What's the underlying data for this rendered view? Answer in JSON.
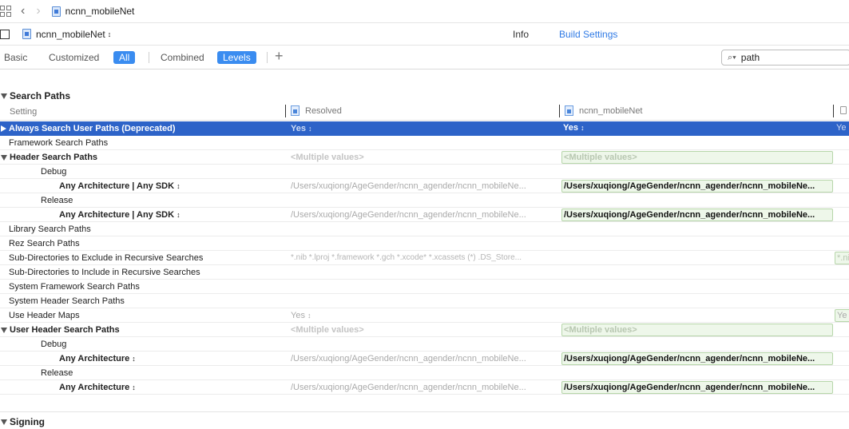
{
  "jumpbar": {
    "file_label": "ncnn_mobileNet"
  },
  "targetbar": {
    "target_label": "ncnn_mobileNet",
    "tab_info": "Info",
    "tab_build_settings": "Build Settings"
  },
  "filterbar": {
    "basic": "Basic",
    "customized": "Customized",
    "all": "All",
    "combined": "Combined",
    "levels": "Levels",
    "search_value": "path"
  },
  "section": {
    "search_paths": "Search Paths",
    "signing": "Signing"
  },
  "columns": {
    "setting": "Setting",
    "resolved": "Resolved",
    "target": "ncnn_mobileNet"
  },
  "rows": [
    {
      "name": "Always Search User Paths (Deprecated)",
      "resolved": "Yes",
      "target": "Yes",
      "extra": "Ye"
    },
    {
      "name": "Framework Search Paths",
      "resolved": "",
      "target": ""
    },
    {
      "name": "Header Search Paths",
      "resolved": "<Multiple values>",
      "target": "<Multiple values>"
    },
    {
      "name": "Debug",
      "resolved": "",
      "target": ""
    },
    {
      "name": "Any Architecture | Any SDK",
      "resolved": "/Users/xuqiong/AgeGender/ncnn_agender/ncnn_mobileNe...",
      "target": "/Users/xuqiong/AgeGender/ncnn_agender/ncnn_mobileNe..."
    },
    {
      "name": "Release",
      "resolved": "",
      "target": ""
    },
    {
      "name": "Any Architecture | Any SDK",
      "resolved": "/Users/xuqiong/AgeGender/ncnn_agender/ncnn_mobileNe...",
      "target": "/Users/xuqiong/AgeGender/ncnn_agender/ncnn_mobileNe..."
    },
    {
      "name": "Library Search Paths",
      "resolved": "",
      "target": ""
    },
    {
      "name": "Rez Search Paths",
      "resolved": "",
      "target": ""
    },
    {
      "name": "Sub-Directories to Exclude in Recursive Searches",
      "resolved": "*.nib *.lproj *.framework *.gch *.xcode* *.xcassets (*) .DS_Store...",
      "target": "",
      "extra": "*.ni"
    },
    {
      "name": "Sub-Directories to Include in Recursive Searches",
      "resolved": "",
      "target": ""
    },
    {
      "name": "System Framework Search Paths",
      "resolved": "",
      "target": ""
    },
    {
      "name": "System Header Search Paths",
      "resolved": "",
      "target": ""
    },
    {
      "name": "Use Header Maps",
      "resolved": "Yes",
      "target": "",
      "extra": "Ye"
    },
    {
      "name": "User Header Search Paths",
      "resolved": "<Multiple values>",
      "target": "<Multiple values>"
    },
    {
      "name": "Debug",
      "resolved": "",
      "target": ""
    },
    {
      "name": "Any Architecture",
      "resolved": "/Users/xuqiong/AgeGender/ncnn_agender/ncnn_mobileNe...",
      "target": "/Users/xuqiong/AgeGender/ncnn_agender/ncnn_mobileNe..."
    },
    {
      "name": "Release",
      "resolved": "",
      "target": ""
    },
    {
      "name": "Any Architecture",
      "resolved": "/Users/xuqiong/AgeGender/ncnn_agender/ncnn_mobileNe...",
      "target": "/Users/xuqiong/AgeGender/ncnn_agender/ncnn_mobileNe..."
    }
  ],
  "colors": {
    "accent": "#2f7ae5",
    "selection": "#2d63c8",
    "override_bg": "#eef7ea"
  }
}
